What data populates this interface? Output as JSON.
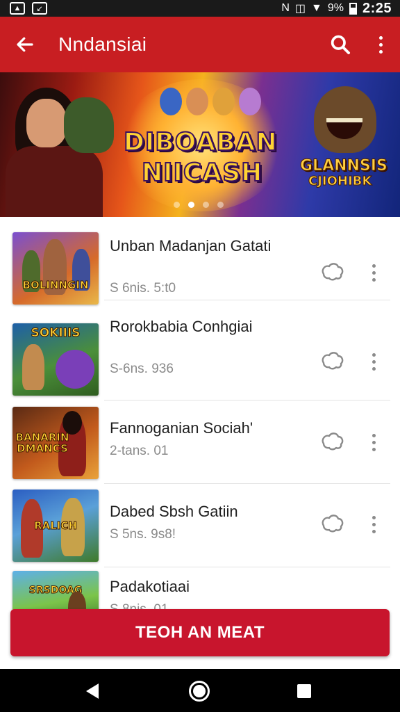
{
  "status_bar": {
    "battery": "9%",
    "time": "2:25",
    "icons": [
      "gallery-icon",
      "download-icon",
      "nfc-icon",
      "vibrate-icon",
      "wifi-icon",
      "battery-icon"
    ]
  },
  "app_bar": {
    "title": "Nndansiai",
    "color": "#c81e22",
    "back_icon": "arrow-left-icon",
    "search_icon": "search-icon",
    "more_icon": "more-vert-icon"
  },
  "banner": {
    "logo_line1": "DIBOABAN",
    "logo_line2": "NIICASH",
    "side_logo_line1": "GLANNSIS",
    "side_logo_line2": "CJIOHIBK",
    "pager_count": 4,
    "pager_active": 1
  },
  "games": [
    {
      "title": "Unban Madanjan Gatati",
      "meta": "S 6nis. 5:t0",
      "thumb_text": "BOLINNGIN"
    },
    {
      "title": "Rorokbabia  Conhgiai",
      "meta": "S-6ns. 936",
      "thumb_text": "SOKIIIS"
    },
    {
      "title": "Fannoganian Sociah'",
      "meta": "2-tans. 01",
      "thumb_text": "BANARIN DMANCS"
    },
    {
      "title": "Dabed Sbsh Gatiin",
      "meta": "S 5ns. 9s8!",
      "thumb_text": "RALICH"
    },
    {
      "title": "Padakotiaai",
      "meta": "S 8nis. 01",
      "thumb_text": "SRSDOAG"
    }
  ],
  "cta": {
    "label": "TEOH AN MEAT",
    "color": "#c8152d"
  }
}
